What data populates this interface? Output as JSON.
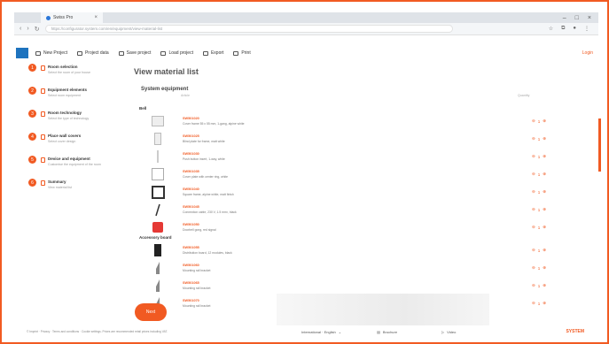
{
  "browser": {
    "tab_title": "Swiss Pro",
    "url": "https://configurator.system.com/en/equipment/view-material-list",
    "window_controls": [
      "–",
      "□",
      "×"
    ]
  },
  "toolbar": {
    "new_project": "New Project",
    "project_data": "Project data",
    "save_project": "Save project",
    "load_project": "Load project",
    "export": "Export",
    "print": "Print",
    "user": "Login"
  },
  "steps": [
    {
      "num": "1",
      "title": "Room selection",
      "sub": "Select the room of your house"
    },
    {
      "num": "2",
      "title": "Equipment elements",
      "sub": "Select room equipment"
    },
    {
      "num": "3",
      "title": "Room technology",
      "sub": "Select the type of technology"
    },
    {
      "num": "4",
      "title": "Place wall covers",
      "sub": "Select cover design"
    },
    {
      "num": "5",
      "title": "Device and equipment",
      "sub": "Customise the equipment of the room"
    },
    {
      "num": "6",
      "title": "Summary",
      "sub": "View material list"
    }
  ],
  "main": {
    "title": "View material list",
    "section": "System equipment",
    "col_article": "Article",
    "col_quantity": "Quantity",
    "group1": "Bell",
    "group2": "Accessory board",
    "items_group1": [
      {
        "code": "SW501020",
        "desc": "Cover frame 55 x 55 mm, 1-gang, alpine white",
        "qty": "1"
      },
      {
        "code": "SW501025",
        "desc": "Blind plate for frame, matt white",
        "qty": "1"
      },
      {
        "code": "SW501030",
        "desc": "Push button insert, 1-way, white",
        "qty": "1"
      },
      {
        "code": "SW501035",
        "desc": "Cover plate with center ring, white",
        "qty": "1"
      },
      {
        "code": "SW501040",
        "desc": "Square frame, alpine white, matt finish",
        "qty": "1"
      },
      {
        "code": "SW501045",
        "desc": "Connection cable, 230 V, 1.5 mm², black",
        "qty": "1"
      },
      {
        "code": "SW501050",
        "desc": "Doorbell gong, red signal",
        "qty": "1"
      }
    ],
    "items_group2": [
      {
        "code": "SW501055",
        "desc": "Distribution board, 12 modules, black",
        "qty": "1"
      },
      {
        "code": "SW501060",
        "desc": "Mounting rail bracket",
        "qty": "1"
      },
      {
        "code": "SW501065",
        "desc": "Mounting rail bracket",
        "qty": "1"
      },
      {
        "code": "SW501070",
        "desc": "Mounting rail bracket",
        "qty": "1"
      }
    ],
    "next_label": "Next"
  },
  "footer": {
    "legal": "© Imprint · Privacy · Terms and conditions · Cookie settings. Prices are recommended retail prices including VAT.",
    "language": "International · English",
    "brochure": "Brochure",
    "video": "Video",
    "brand": "SYSTEM"
  },
  "colors": {
    "accent": "#f15a22",
    "logo": "#1e73be"
  }
}
